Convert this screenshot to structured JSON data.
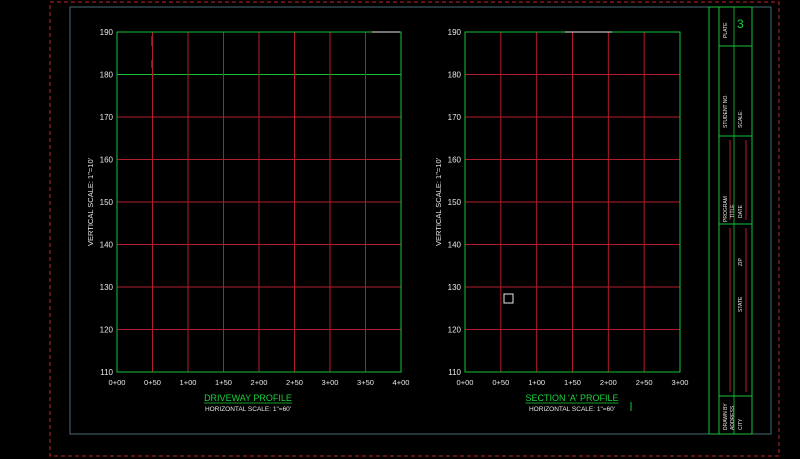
{
  "colors": {
    "background": "#000000",
    "frame": "#4a6b73",
    "border_dashed": "#c0262a",
    "plot_frame": "#17c23a",
    "grid": "#b31c2a",
    "axis_text": "#e8e8e8",
    "title_text": "#19d33d",
    "title_block": "#17c23a"
  },
  "chart_data": [
    {
      "type": "table",
      "title": "DRIVEWAY PROFILE",
      "subtitle": "HORIZONTAL SCALE: 1\"=60'",
      "ylabel": "VERTICAL SCALE: 1\"=10'",
      "xlabel": "",
      "x_ticks": [
        "0+00",
        "0+50",
        "1+00",
        "1+50",
        "2+00",
        "2+50",
        "3+00",
        "3+50",
        "4+00"
      ],
      "y_ticks": [
        110,
        120,
        130,
        140,
        150,
        160,
        170,
        180,
        190
      ],
      "ylim": [
        110,
        190
      ],
      "grid": true
    },
    {
      "type": "table",
      "title": "SECTION 'A' PROFILE",
      "subtitle": "HORIZONTAL SCALE: 1\"=60'",
      "ylabel": "VERTICAL SCALE: 1\"=10'",
      "xlabel": "",
      "x_ticks": [
        "0+00",
        "0+50",
        "1+00",
        "1+50",
        "2+00",
        "2+50",
        "3+00"
      ],
      "y_ticks": [
        110,
        120,
        130,
        140,
        150,
        160,
        170,
        180,
        190
      ],
      "ylim": [
        110,
        190
      ],
      "grid": true
    }
  ],
  "title_block": {
    "plate_label": "PLATE",
    "plate_number": "3",
    "student_no_label": "STUDENT NO.",
    "scale_label": "SCALE:",
    "program_label": "PROGRAM",
    "title_label": "TITLE",
    "date_label": "DATE",
    "zip_label": "ZIP",
    "state_label": "STATE",
    "drawn_by_label": "DRAWN BY",
    "address_label": "ADDRESS",
    "city_label": "CITY"
  }
}
